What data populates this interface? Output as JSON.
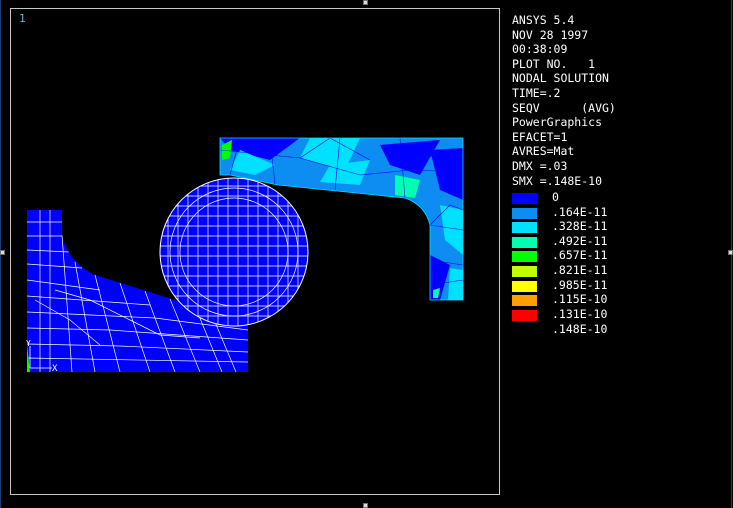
{
  "window": {
    "number": "1"
  },
  "info_lines": [
    "ANSYS 5.4",
    "NOV 28 1997",
    "00:38:09",
    "PLOT NO.   1",
    "NODAL SOLUTION",
    "TIME=.2",
    "SEQV      (AVG)",
    "PowerGraphics",
    "EFACET=1",
    "AVRES=Mat",
    "DMX =.03",
    "SMX =.148E-10"
  ],
  "legend": {
    "bands": [
      {
        "label": "0",
        "color": "#0000ff"
      },
      {
        "label": ".164E-11",
        "color": "#0d8df2"
      },
      {
        "label": ".328E-11",
        "color": "#00e0ff"
      },
      {
        "label": ".492E-11",
        "color": "#00ffb0"
      },
      {
        "label": ".657E-11",
        "color": "#00ff00"
      },
      {
        "label": ".821E-11",
        "color": "#bfff00"
      },
      {
        "label": ".985E-11",
        "color": "#ffff00"
      },
      {
        "label": ".115E-10",
        "color": "#ffa000"
      },
      {
        "label": ".131E-10",
        "color": "#ff0000"
      }
    ],
    "max_label": ".148E-10"
  },
  "axis_triad": {
    "y_label": "Y",
    "x_label": "X"
  },
  "colors": {
    "background": "#000000",
    "mesh_lines": "#ffffff",
    "model_base": "#0000ff",
    "frame": "#c8c8c8"
  }
}
